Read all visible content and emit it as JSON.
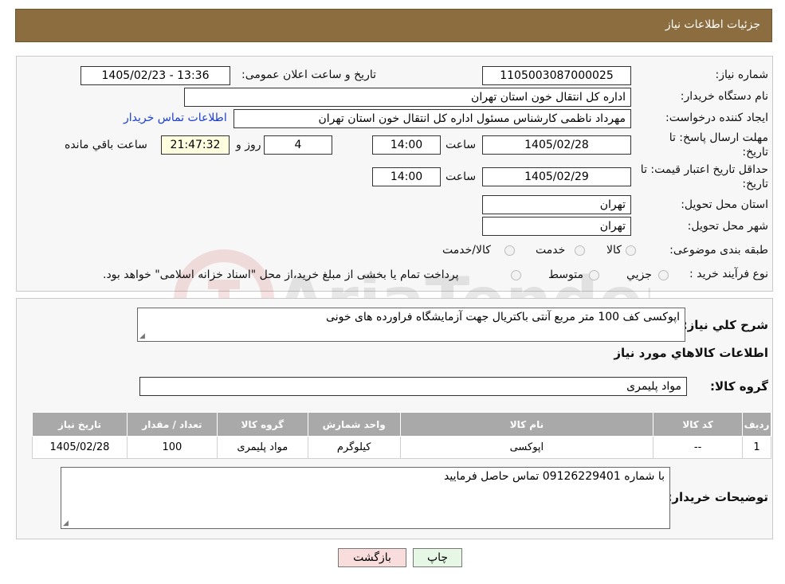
{
  "header": {
    "title": "جزئیات اطلاعات نیاز"
  },
  "form": {
    "need_number_label": "شماره نیاز:",
    "need_number": "1105003087000025",
    "announce_label": "تاریخ و ساعت اعلان عمومی:",
    "announce_value": "1405/02/23 - 13:36",
    "buyer_org_label": "نام دستگاه خریدار:",
    "buyer_org": "اداره کل انتقال خون استان تهران",
    "requester_label": "ایجاد کننده درخواست:",
    "requester": "مهرداد ناظمی کارشناس مسئول اداره کل انتقال خون استان تهران",
    "contact_link": "اطلاعات تماس خریدار",
    "deadline_label_1": "مهلت ارسال پاسخ: تا",
    "deadline_label_2": "تاریخ:",
    "deadline_date": "1405/02/28",
    "time_label": "ساعت",
    "deadline_time": "14:00",
    "days_value": "4",
    "days_label": "روز و",
    "remaining_time": "21:47:32",
    "remaining_label": "ساعت باقي مانده",
    "validity_label_1": "حداقل تاریخ اعتبار قیمت: تا",
    "validity_label_2": "تاریخ:",
    "validity_date": "1405/02/29",
    "validity_time": "14:00",
    "province_label": "استان محل تحویل:",
    "province": "تهران",
    "city_label": "شهر محل تحویل:",
    "city": "تهران",
    "category_label": "طبقه بندی موضوعی:",
    "category_options": [
      "کالا",
      "خدمت",
      "کالا/خدمت"
    ],
    "process_label": "نوع فرآیند خرید :",
    "process_options": [
      "جزيي",
      "متوسط"
    ],
    "process_note": "پرداخت تمام یا بخشی از مبلغ خرید،از محل \"اسناد خزانه اسلامی\" خواهد بود."
  },
  "details": {
    "description_label": "شرح كلي نياز:",
    "description": "اپوکسی کف 100 متر مربع آنتی باکتریال جهت آزمایشگاه فراورده های خونی",
    "items_title": "اطلاعات كالاهاي مورد نياز",
    "group_label": "گروه کالا:",
    "group_value": "مواد پلیمری",
    "table": {
      "headers": [
        "ردیف",
        "کد کالا",
        "نام کالا",
        "واحد شمارش",
        "گروه کالا",
        "تعداد / مقدار",
        "تاریخ نیاز"
      ],
      "rows": [
        [
          "1",
          "--",
          "اپوکسی",
          "کیلوگرم",
          "مواد پلیمری",
          "100",
          "1405/02/28"
        ]
      ]
    },
    "buyer_notes_label": "توضیحات خریدار:",
    "buyer_notes": "با شماره 09126229401 تماس حاصل فرمایید"
  },
  "buttons": {
    "print": "چاپ",
    "back": "بازگشت"
  },
  "colors": {
    "header_bg": "#8c6d3f",
    "table_header_bg": "#a9a9a9",
    "back_btn_bg": "#f9dcdc",
    "print_btn_bg": "#e6f7e6",
    "link": "#1a3fd0"
  }
}
